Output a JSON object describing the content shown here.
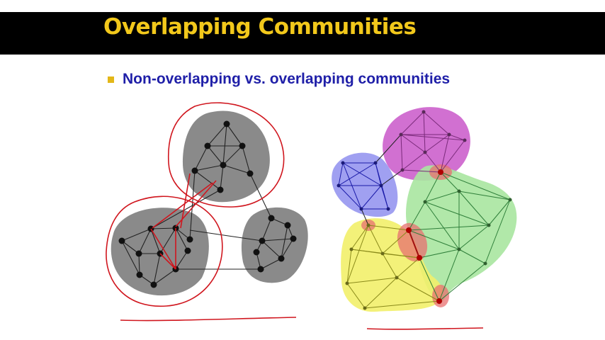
{
  "slide": {
    "title": "Overlapping Communities",
    "bullet": "Non-overlapping vs. overlapping  communities"
  },
  "colors": {
    "title_bar": "#000000",
    "title_text": "#f2c81b",
    "bullet_text": "#1f1fa8",
    "community_gray": "#8a8a8a",
    "community_magenta": "#c957c9",
    "community_blue": "#8f8fee",
    "community_green": "#a8e6a0",
    "community_yellow": "#f2f06a",
    "overlap_red": "#e87070",
    "annotation_red": "#d0161e"
  },
  "figures": {
    "left": "non-overlapping-graph",
    "right": "overlapping-graph"
  }
}
